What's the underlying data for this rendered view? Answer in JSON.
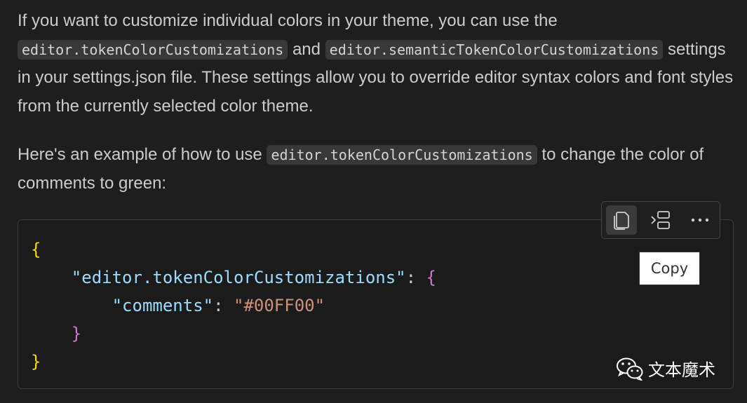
{
  "paragraph1": {
    "text1": "If you want to customize individual colors in your theme, you can use the ",
    "code1": "editor.tokenColorCustomizations",
    "text2": " and ",
    "code2": "editor.semanticTokenColorCustomizations",
    "text3": " settings in your settings.json file. These settings allow you to override editor syntax colors and font styles from the currently selected color theme."
  },
  "paragraph2": {
    "text1": "Here's an example of how to use ",
    "code1": "editor.tokenColorCustomizations",
    "text2": " to change the color of comments to green:"
  },
  "code": {
    "open_brace": "{",
    "indent1": "    ",
    "key1": "\"editor.tokenColorCustomizations\"",
    "colon1": ": ",
    "inner_open": "{",
    "indent2": "        ",
    "key2": "\"comments\"",
    "colon2": ": ",
    "value2": "\"#00FF00\"",
    "inner_close": "}",
    "close_brace": "}"
  },
  "toolbar": {
    "copy_icon": "copy-icon",
    "insert_icon": "insert-at-cursor-icon",
    "more_icon": "more-actions-icon",
    "more_glyph": "···"
  },
  "tooltip": {
    "label": "Copy"
  },
  "watermark": {
    "icon": "wechat-icon",
    "text": "文本魔术"
  },
  "colors": {
    "background": "#1e1e1e",
    "text": "#cccccc",
    "inline_code_bg": "#383838",
    "brace_level1": "#ffd700",
    "brace_level2": "#da70d6",
    "json_key": "#9cdcfe",
    "json_string": "#ce9178"
  }
}
